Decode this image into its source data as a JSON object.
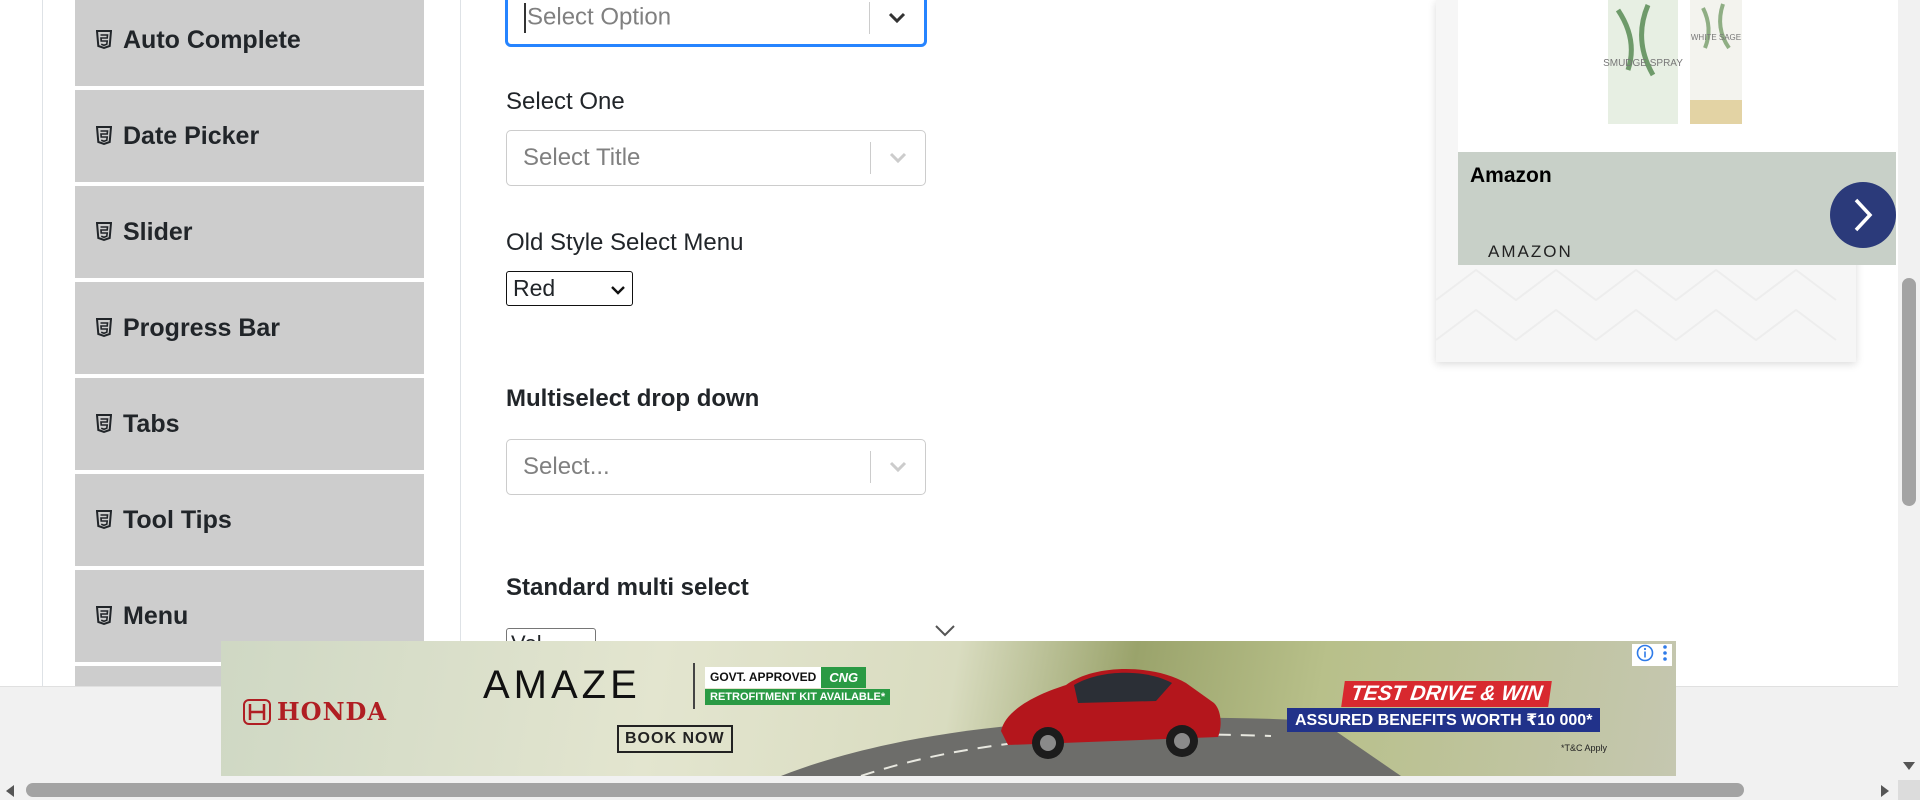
{
  "sidebar": {
    "items": [
      {
        "label": "Auto Complete",
        "icon": "html5-icon"
      },
      {
        "label": "Date Picker",
        "icon": "html5-icon"
      },
      {
        "label": "Slider",
        "icon": "html5-icon"
      },
      {
        "label": "Progress Bar",
        "icon": "html5-icon"
      },
      {
        "label": "Tabs",
        "icon": "html5-icon"
      },
      {
        "label": "Tool Tips",
        "icon": "html5-icon"
      },
      {
        "label": "Menu",
        "icon": "html5-icon"
      }
    ]
  },
  "form": {
    "select_value": {
      "placeholder": "Select Option"
    },
    "select_one": {
      "label": "Select One",
      "placeholder": "Select Title"
    },
    "old_style": {
      "label": "Old Style Select Menu",
      "value": "Red"
    },
    "multiselect": {
      "heading": "Multiselect drop down",
      "placeholder": "Select..."
    },
    "standard_multi": {
      "heading": "Standard multi select",
      "visible_text": "Vol"
    }
  },
  "ad_card": {
    "product_name": "Amazon",
    "brand": "AMAZON",
    "product_labels": [
      "SMUDGE SPRAY",
      "WHITE SAGE"
    ]
  },
  "banner": {
    "brand": "HONDA",
    "model": "AMAZE",
    "badge_top": "GOVT. APPROVED",
    "badge_cng": "CNG",
    "badge_bottom": "RETROFITMENT KIT AVAILABLE*",
    "cta": "BOOK NOW",
    "headline": "TEST DRIVE & WIN",
    "subline": "ASSURED BENEFITS WORTH ₹10 000*",
    "fine_print": "*T&C Apply"
  },
  "colors": {
    "sidebar_bg": "#cdcdcd",
    "focus_blue": "#2684ff",
    "ad_button": "#2b3a7a",
    "banner_red": "#d8292f"
  }
}
